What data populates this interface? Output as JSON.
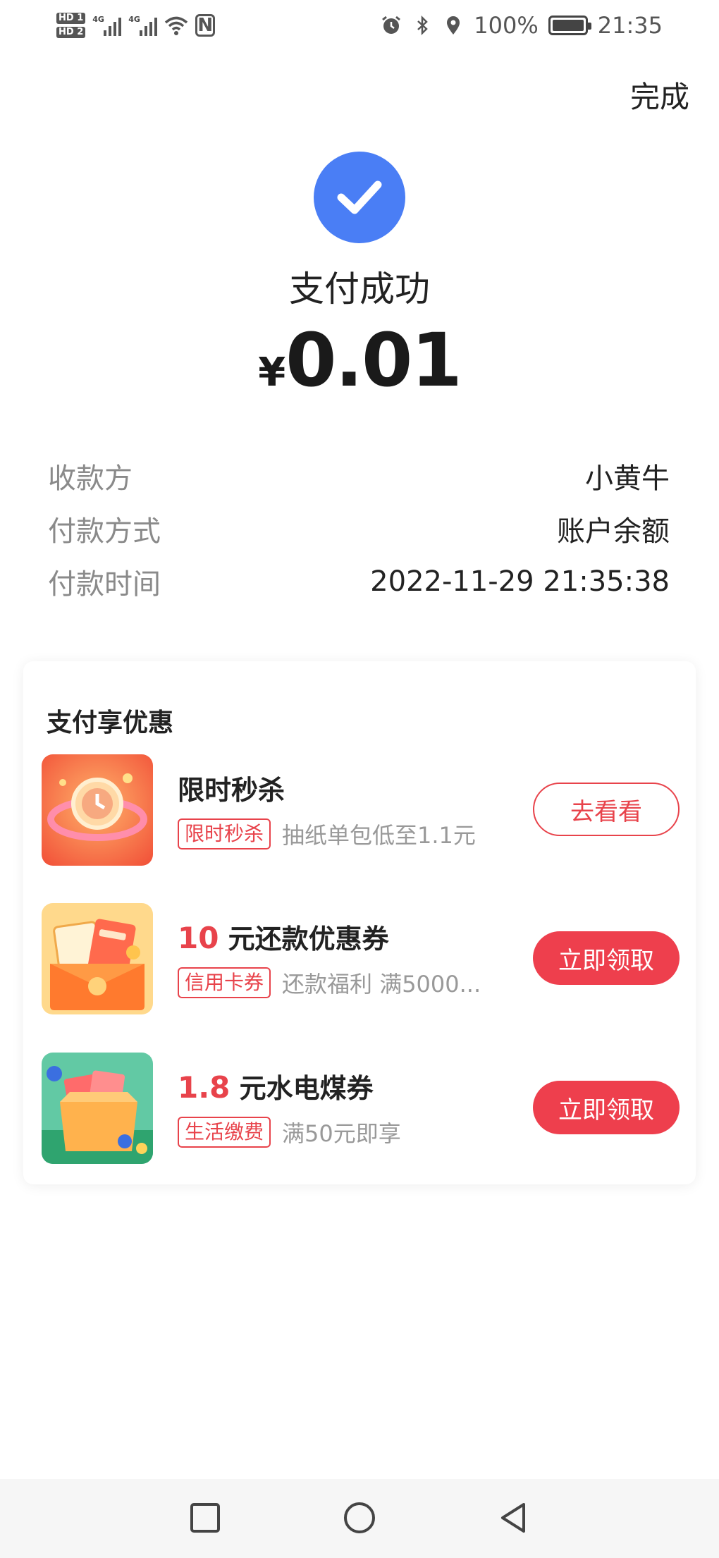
{
  "status_bar": {
    "hd1": "HD 1",
    "hd2": "HD 2",
    "net1": "4G",
    "net2": "4G",
    "battery_pct": "100%",
    "time": "21:35"
  },
  "header": {
    "done_label": "完成"
  },
  "payment": {
    "status": "支付成功",
    "currency": "¥",
    "amount": "0.01"
  },
  "details": [
    {
      "label": "收款方",
      "value": "小黄牛"
    },
    {
      "label": "付款方式",
      "value": "账户余额"
    },
    {
      "label": "付款时间",
      "value": "2022-11-29 21:35:38"
    }
  ],
  "promo": {
    "title": "支付享优惠",
    "offers": [
      {
        "highlight": "",
        "name": "限时秒杀",
        "tag": "限时秒杀",
        "desc": "抽纸单包低至1.1元",
        "button": "去看看",
        "style": "outline"
      },
      {
        "highlight": "10",
        "name": " 元还款优惠券",
        "tag": "信用卡券",
        "desc": "还款福利 满5000...",
        "button": "立即领取",
        "style": "solid"
      },
      {
        "highlight": "1.8",
        "name": " 元水电煤券",
        "tag": "生活缴费",
        "desc": "满50元即享",
        "button": "立即领取",
        "style": "solid"
      }
    ]
  },
  "colors": {
    "accent_blue": "#4a7ef5",
    "accent_red": "#e8434b"
  },
  "icons": [
    "alarm-icon",
    "bluetooth-icon",
    "location-icon",
    "battery-icon",
    "wifi-icon",
    "nfc-icon",
    "checkmark-icon",
    "nav-recent-icon",
    "nav-home-icon",
    "nav-back-icon"
  ]
}
